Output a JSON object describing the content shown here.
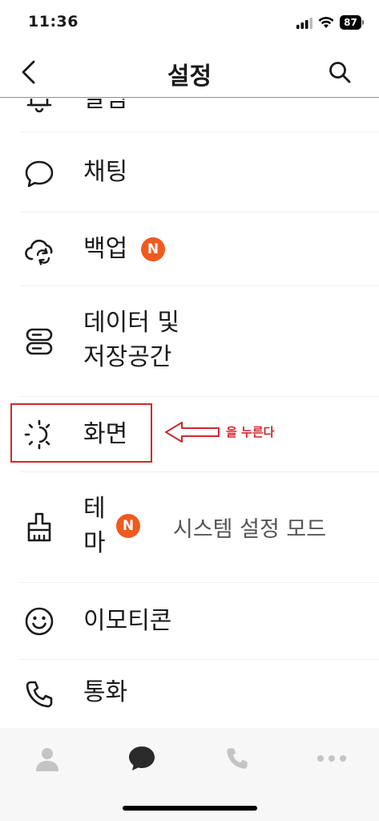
{
  "status_bar": {
    "time": "11:36",
    "battery": "87"
  },
  "header": {
    "title": "설정",
    "back_icon": "chevron-left-icon",
    "search_icon": "search-icon"
  },
  "settings": {
    "items": [
      {
        "label": "알림",
        "icon": "bell-icon"
      },
      {
        "label": "채팅",
        "icon": "chat-bubble-icon"
      },
      {
        "label": "백업",
        "icon": "cloud-sync-icon",
        "badge": "N"
      },
      {
        "label_line1": "데이터 및",
        "label_line2": "저장공간",
        "icon": "storage-icon"
      },
      {
        "label": "화면",
        "icon": "brightness-icon"
      },
      {
        "label_line1": "테",
        "label_line2": "마",
        "icon": "paint-brush-icon",
        "badge": "N",
        "value": "시스템 설정 모드"
      },
      {
        "label": "이모티콘",
        "icon": "smiley-icon"
      },
      {
        "label": "통화",
        "icon": "phone-icon"
      }
    ]
  },
  "annotation": {
    "text": "을 누른다",
    "color": "#d6262b"
  },
  "tab_bar": {
    "tabs": [
      {
        "icon": "person-icon"
      },
      {
        "icon": "chat-icon"
      },
      {
        "icon": "call-icon"
      },
      {
        "icon": "more-icon"
      }
    ]
  },
  "colors": {
    "badge": "#f05a1e",
    "highlight": "#d6262b"
  }
}
